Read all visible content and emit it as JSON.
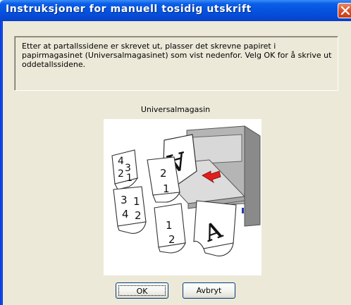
{
  "window": {
    "title": "Instruksjoner for manuell tosidig utskrift"
  },
  "titlebar_buttons": {
    "close_icon": "close-icon"
  },
  "instructions": {
    "text": "Etter at partallssidene er skrevet ut, plasser det skrevne papiret i papirmagasinet (Universalmagasinet) som vist nedenfor. Velg OK for å skrive ut oddetallssidene."
  },
  "illustration": {
    "label": "Universalmagasin",
    "page_glyphs": [
      "A",
      "4",
      "3",
      "2",
      "1",
      "2",
      "1",
      "3",
      "4",
      "1",
      "2",
      "1",
      "2",
      "A"
    ]
  },
  "buttons": {
    "ok": "OK",
    "cancel": "Avbryt"
  },
  "colors": {
    "titlebar": "#0553de",
    "dialog_background": "#ece9d8",
    "arrow": "#e0201c"
  }
}
